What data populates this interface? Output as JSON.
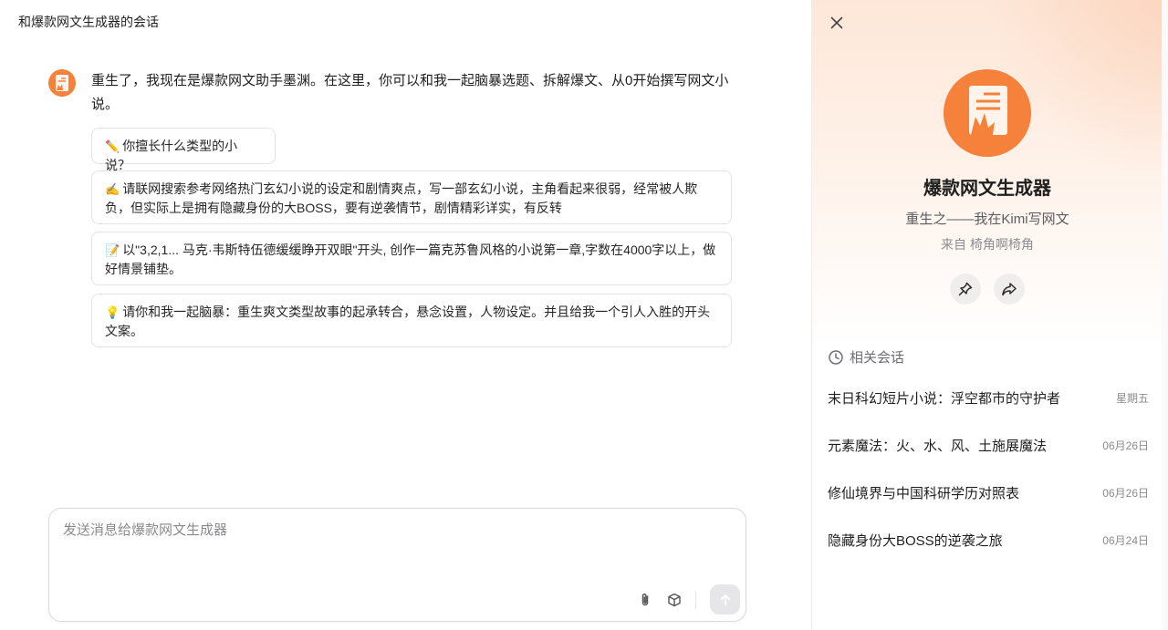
{
  "conversation": {
    "title": "和爆款网文生成器的会话"
  },
  "chat": {
    "greeting": "重生了，我现在是爆款网文助手墨渊。在这里，你可以和我一起脑暴选题、拆解爆文、从0开始撰写网文小说。",
    "suggestions": [
      {
        "emoji": "✏️",
        "text": "你擅长什么类型的小说？"
      },
      {
        "emoji": "✍️",
        "text": "请联网搜索参考网络热门玄幻小说的设定和剧情爽点，写一部玄幻小说，主角看起来很弱，经常被人欺负，但实际上是拥有隐藏身份的大BOSS，要有逆袭情节，剧情精彩详实，有反转"
      },
      {
        "emoji": "📝",
        "text": "以\"3,2,1... 马克·韦斯特伍德缓缓睁开双眼\"开头, 创作一篇克苏鲁风格的小说第一章,字数在4000字以上，做好情景铺垫。"
      },
      {
        "emoji": "💡",
        "text": "请你和我一起脑暴：重生爽文类型故事的起承转合，悬念设置，人物设定。并且给我一个引人入胜的开头文案。"
      }
    ]
  },
  "input": {
    "placeholder": "发送消息给爆款网文生成器",
    "value": ""
  },
  "panel": {
    "bot_name": "爆款网文生成器",
    "description": "重生之——我在Kimi写网文",
    "author_prefix": "来自 ",
    "author": "椅角啊椅角",
    "related_title": "相关会话",
    "related": [
      {
        "title": "末日科幻短片小说：浮空都市的守护者",
        "date": "星期五"
      },
      {
        "title": "元素魔法：火、水、风、土施展魔法",
        "date": "06月26日"
      },
      {
        "title": "修仙境界与中国科研学历对照表",
        "date": "06月26日"
      },
      {
        "title": "隐藏身份大BOSS的逆袭之旅",
        "date": "06月24日"
      }
    ]
  },
  "colors": {
    "accent": "#f5813a",
    "panel_gradient_top": "#fde7d8",
    "send_disabled": "#e6e6e9"
  },
  "icons": {
    "bot_avatar": "document-spark-icon",
    "attach": "paperclip-icon",
    "box": "cube-icon",
    "send": "arrow-up-icon",
    "close": "close-icon",
    "pin": "pin-icon",
    "share": "share-icon",
    "related": "clock-icon"
  }
}
